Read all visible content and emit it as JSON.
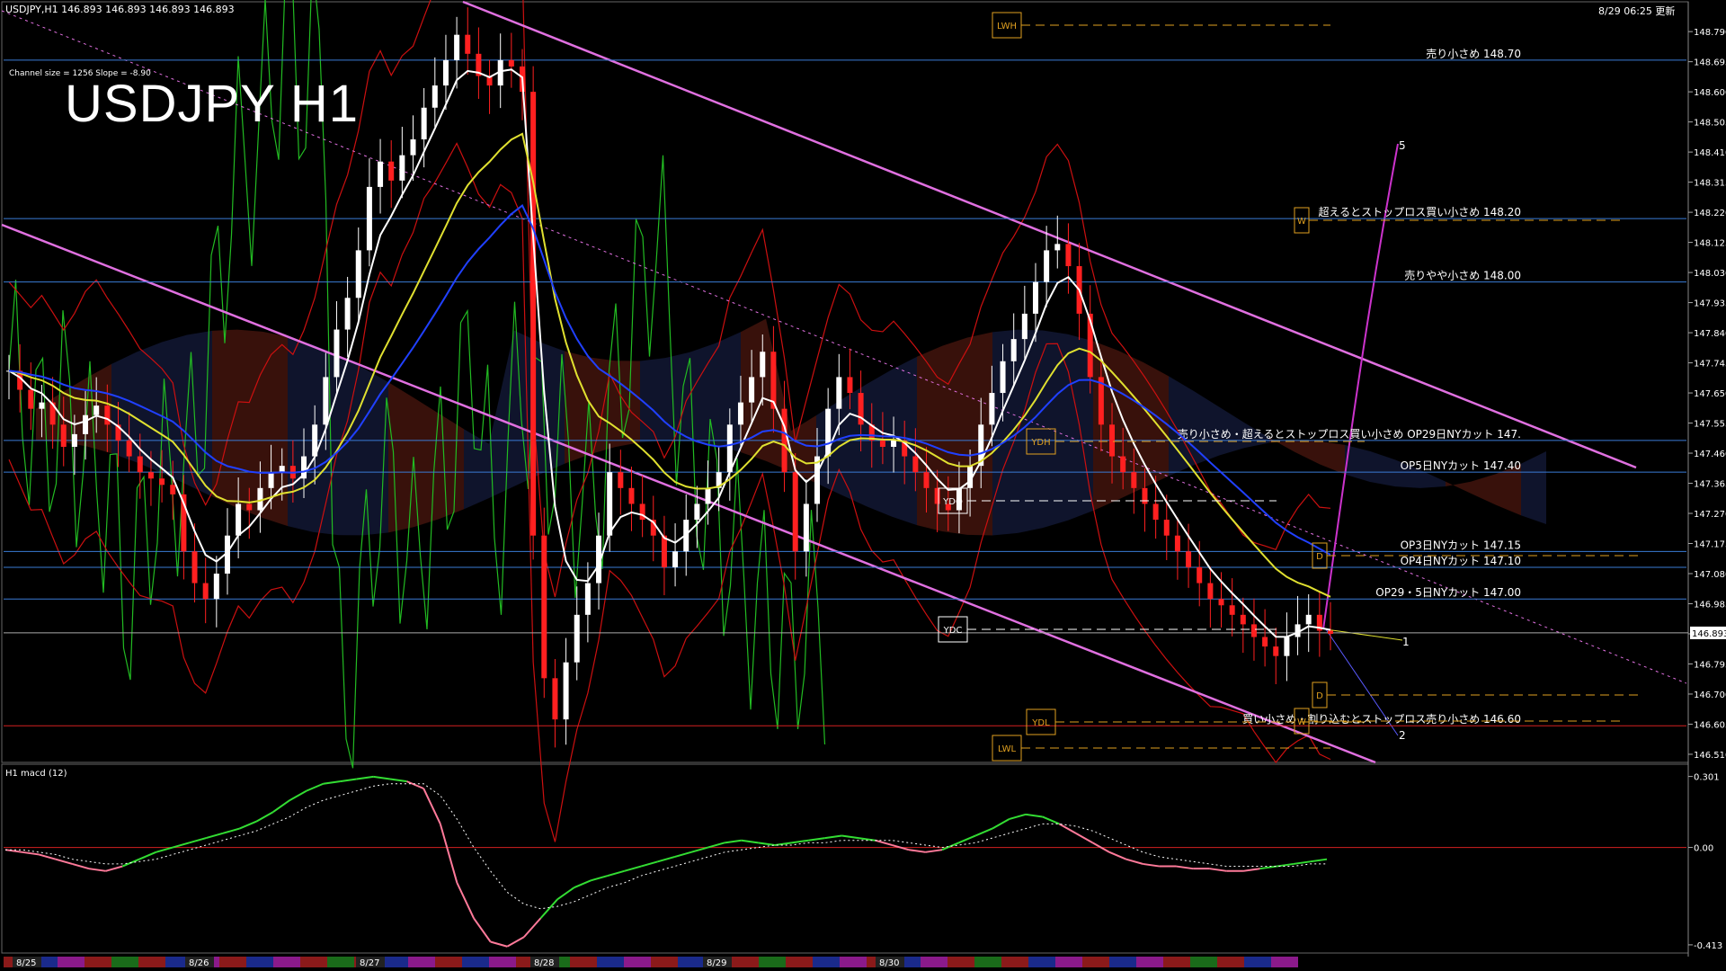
{
  "header": {
    "symbol_info": "USDJPY,H1  146.893 146.893 146.893 146.893",
    "timestamp": "8/29 06:25 更新",
    "channel_info": "Channel size = 1256 Slope = -8.90",
    "title": "USDJPY H1",
    "macd_label": "H1  macd (12)"
  },
  "chart_data": {
    "type": "line",
    "title": "USDJPY H1",
    "price_axis": {
      "ticks": [
        "148.790",
        "148.695",
        "148.600",
        "148.505",
        "148.410",
        "148.315",
        "148.220",
        "148.125",
        "148.030",
        "147.935",
        "147.840",
        "147.745",
        "147.650",
        "147.555",
        "147.460",
        "147.365",
        "147.270",
        "147.175",
        "147.080",
        "146.985",
        "146.890",
        "146.795",
        "146.700",
        "146.605",
        "146.510"
      ],
      "ylim": [
        146.49,
        148.85
      ],
      "current_price": "146.893"
    },
    "macd_axis": {
      "ticks": [
        "0.301",
        "0.00",
        "-0.413"
      ],
      "ylim": [
        -0.44,
        0.33
      ]
    },
    "x_dates": [
      "8/25",
      "8/26",
      "8/27",
      "8/28",
      "8/29",
      "8/30"
    ],
    "level_lines": [
      {
        "price": 148.7,
        "label": "売り小さめ 148.70",
        "color": "#3a7bd5"
      },
      {
        "price": 148.2,
        "label": "超えるとストップロス買い小さめ 148.20",
        "color": "#3a7bd5"
      },
      {
        "price": 148.0,
        "label": "売りやや小さめ 148.00",
        "color": "#3a7bd5"
      },
      {
        "price": 147.5,
        "label": "売り小さめ・超えるとストップロス買い小さめ OP29日NYカット 147.",
        "color": "#3a7bd5"
      },
      {
        "price": 147.4,
        "label": "OP5日NYカット 147.40",
        "color": "#3a7bd5"
      },
      {
        "price": 147.15,
        "label": "OP3日NYカット 147.15",
        "color": "#3a7bd5"
      },
      {
        "price": 147.1,
        "label": "OP4日NYカット 147.10",
        "color": "#3a7bd5"
      },
      {
        "price": 147.0,
        "label": "OP29・5日NYカット 147.00",
        "color": "#3a7bd5"
      },
      {
        "price": 146.6,
        "label": "買い小さめ・割り込むとストップロス売り小さめ 146.60",
        "color": "#d42020"
      }
    ],
    "markers": [
      "LWH",
      "YDH",
      "YDO",
      "YDC",
      "YDL",
      "LWL",
      "W",
      "D",
      "D",
      "W"
    ],
    "projection_labels": [
      "5",
      "1",
      "2"
    ],
    "close_series": [
      147.72,
      147.66,
      147.6,
      147.62,
      147.55,
      147.48,
      147.52,
      147.58,
      147.61,
      147.55,
      147.5,
      147.45,
      147.4,
      147.38,
      147.36,
      147.33,
      147.15,
      147.05,
      147.0,
      147.08,
      147.2,
      147.3,
      147.28,
      147.35,
      147.4,
      147.42,
      147.38,
      147.45,
      147.55,
      147.7,
      147.85,
      147.95,
      148.1,
      148.3,
      148.38,
      148.32,
      148.4,
      148.45,
      148.55,
      148.62,
      148.7,
      148.78,
      148.72,
      148.65,
      148.62,
      148.7,
      148.68,
      148.6,
      147.2,
      146.75,
      146.62,
      146.8,
      146.95,
      147.05,
      147.2,
      147.4,
      147.35,
      147.3,
      147.25,
      147.2,
      147.1,
      147.15,
      147.25,
      147.3,
      147.35,
      147.4,
      147.55,
      147.62,
      147.7,
      147.78,
      147.6,
      147.4,
      147.15,
      147.3,
      147.45,
      147.6,
      147.7,
      147.65,
      147.55,
      147.5,
      147.48,
      147.5,
      147.45,
      147.4,
      147.35,
      147.3,
      147.28,
      147.35,
      147.42,
      147.55,
      147.65,
      147.75,
      147.82,
      147.9,
      148.0,
      148.1,
      148.12,
      148.05,
      147.9,
      147.7,
      147.55,
      147.45,
      147.4,
      147.35,
      147.3,
      147.25,
      147.2,
      147.15,
      147.1,
      147.05,
      147.0,
      146.98,
      146.95,
      146.92,
      146.88,
      146.85,
      146.82,
      146.88,
      146.92,
      146.95,
      146.9,
      146.89
    ],
    "macd_values": [
      -0.01,
      -0.02,
      -0.03,
      -0.05,
      -0.07,
      -0.09,
      -0.1,
      -0.08,
      -0.05,
      -0.02,
      0.0,
      0.02,
      0.04,
      0.06,
      0.08,
      0.11,
      0.15,
      0.2,
      0.24,
      0.27,
      0.28,
      0.29,
      0.3,
      0.29,
      0.28,
      0.25,
      0.1,
      -0.15,
      -0.3,
      -0.4,
      -0.42,
      -0.38,
      -0.3,
      -0.22,
      -0.17,
      -0.14,
      -0.12,
      -0.1,
      -0.08,
      -0.06,
      -0.04,
      -0.02,
      0.0,
      0.02,
      0.03,
      0.02,
      0.01,
      0.02,
      0.03,
      0.04,
      0.05,
      0.04,
      0.03,
      0.01,
      -0.01,
      -0.02,
      -0.01,
      0.02,
      0.05,
      0.08,
      0.12,
      0.14,
      0.13,
      0.1,
      0.06,
      0.02,
      -0.02,
      -0.05,
      -0.07,
      -0.08,
      -0.08,
      -0.09,
      -0.09,
      -0.1,
      -0.1,
      -0.09,
      -0.08,
      -0.07,
      -0.06,
      -0.05
    ],
    "macd_signal": [
      -0.01,
      -0.01,
      -0.02,
      -0.03,
      -0.05,
      -0.06,
      -0.07,
      -0.07,
      -0.06,
      -0.05,
      -0.03,
      -0.01,
      0.01,
      0.03,
      0.05,
      0.07,
      0.1,
      0.13,
      0.17,
      0.2,
      0.22,
      0.24,
      0.26,
      0.27,
      0.27,
      0.27,
      0.22,
      0.12,
      0.0,
      -0.1,
      -0.19,
      -0.24,
      -0.26,
      -0.25,
      -0.23,
      -0.2,
      -0.17,
      -0.15,
      -0.12,
      -0.1,
      -0.08,
      -0.06,
      -0.04,
      -0.02,
      -0.01,
      0.0,
      0.01,
      0.01,
      0.02,
      0.02,
      0.03,
      0.03,
      0.03,
      0.03,
      0.02,
      0.01,
      0.0,
      0.01,
      0.02,
      0.04,
      0.06,
      0.08,
      0.1,
      0.1,
      0.09,
      0.07,
      0.04,
      0.01,
      -0.02,
      -0.04,
      -0.05,
      -0.06,
      -0.07,
      -0.08,
      -0.08,
      -0.08,
      -0.08,
      -0.08,
      -0.07,
      -0.07
    ]
  },
  "colors": {
    "background": "#000000",
    "grid_level": "#3a7bd5",
    "red_level": "#d42020",
    "channel": "#e070e0",
    "ema_white": "#ffffff",
    "ema_yellow": "#e0e030",
    "ema_blue": "#2040ff",
    "bollinger": "#cc1010",
    "chikou": "#22bb22",
    "macd_up": "#33dd33",
    "macd_down": "#ff7a9a"
  }
}
